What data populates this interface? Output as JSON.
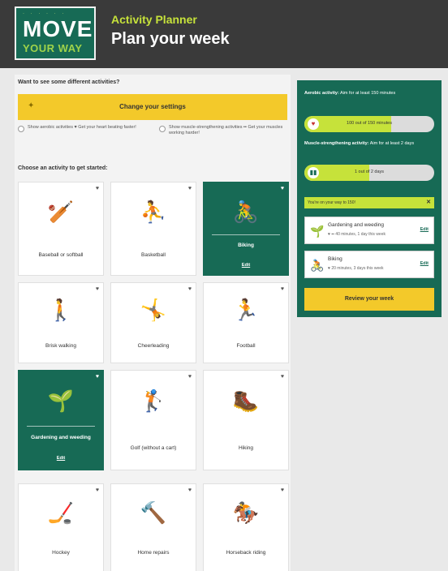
{
  "header": {
    "logo_top": "· · · · · ·",
    "logo_line1": "MOVE",
    "logo_line2": "YOUR WAY",
    "app_title": "Activity Planner",
    "page_title": "Plan your week"
  },
  "settings": {
    "intro": "Want to see some different activities?",
    "button_label": "Change your settings",
    "option_aerobic": "Show aerobic activities ♥ Get your heart beating faster!",
    "option_muscle": "Show muscle-strengthening activities ▪▪ Get your muscles working harder!"
  },
  "activities": {
    "heading": "Choose an activity to get started:",
    "edit_label": "Edit",
    "items": [
      {
        "name": "Baseball or softball",
        "icon": "baseball-icon",
        "glyph": "🏏",
        "selected": false
      },
      {
        "name": "Basketball",
        "icon": "basketball-icon",
        "glyph": "⛹",
        "selected": false
      },
      {
        "name": "Biking",
        "icon": "bike-icon",
        "glyph": "🚴",
        "selected": true
      },
      {
        "name": "Brisk walking",
        "icon": "walking-icon",
        "glyph": "🚶",
        "selected": false
      },
      {
        "name": "Cheerleading",
        "icon": "cheerleading-icon",
        "glyph": "🤸",
        "selected": false
      },
      {
        "name": "Football",
        "icon": "football-icon",
        "glyph": "🏃",
        "selected": false
      },
      {
        "name": "Gardening and weeding",
        "icon": "gardening-icon",
        "glyph": "🌱",
        "selected": true
      },
      {
        "name": "Golf (without a cart)",
        "icon": "golf-icon",
        "glyph": "🏌",
        "selected": false
      },
      {
        "name": "Hiking",
        "icon": "hiking-icon",
        "glyph": "🥾",
        "selected": false
      },
      {
        "name": "Hockey",
        "icon": "hockey-icon",
        "glyph": "🏒",
        "selected": false
      },
      {
        "name": "Home repairs",
        "icon": "home-repairs-icon",
        "glyph": "🔨",
        "selected": false
      },
      {
        "name": "Horseback riding",
        "icon": "horse-icon",
        "glyph": "🏇",
        "selected": false
      }
    ]
  },
  "summary": {
    "aerobic_label": "Aerobic activity:",
    "aerobic_goal": "Aim for at least 150 minutes",
    "aerobic_progress_text": "100 out of 150 minutes",
    "aerobic_progress": 0.67,
    "muscle_label": "Muscle-strengthening activity:",
    "muscle_goal": "Aim for at least 2 days",
    "muscle_progress_text": "1 out of 2 days",
    "muscle_progress": 0.5,
    "track_message": "You're on your way to 150!",
    "close_label": "✕",
    "plan": [
      {
        "title": "Gardening and weeding",
        "detail": "♥ ▪▪ 40 minutes, 1 day this week",
        "glyph": "🌱"
      },
      {
        "title": "Biking",
        "detail": "♥ 20 minutes, 3 days this week",
        "glyph": "🚴"
      }
    ],
    "edit_label": "Edit",
    "review_label": "Review your week"
  }
}
